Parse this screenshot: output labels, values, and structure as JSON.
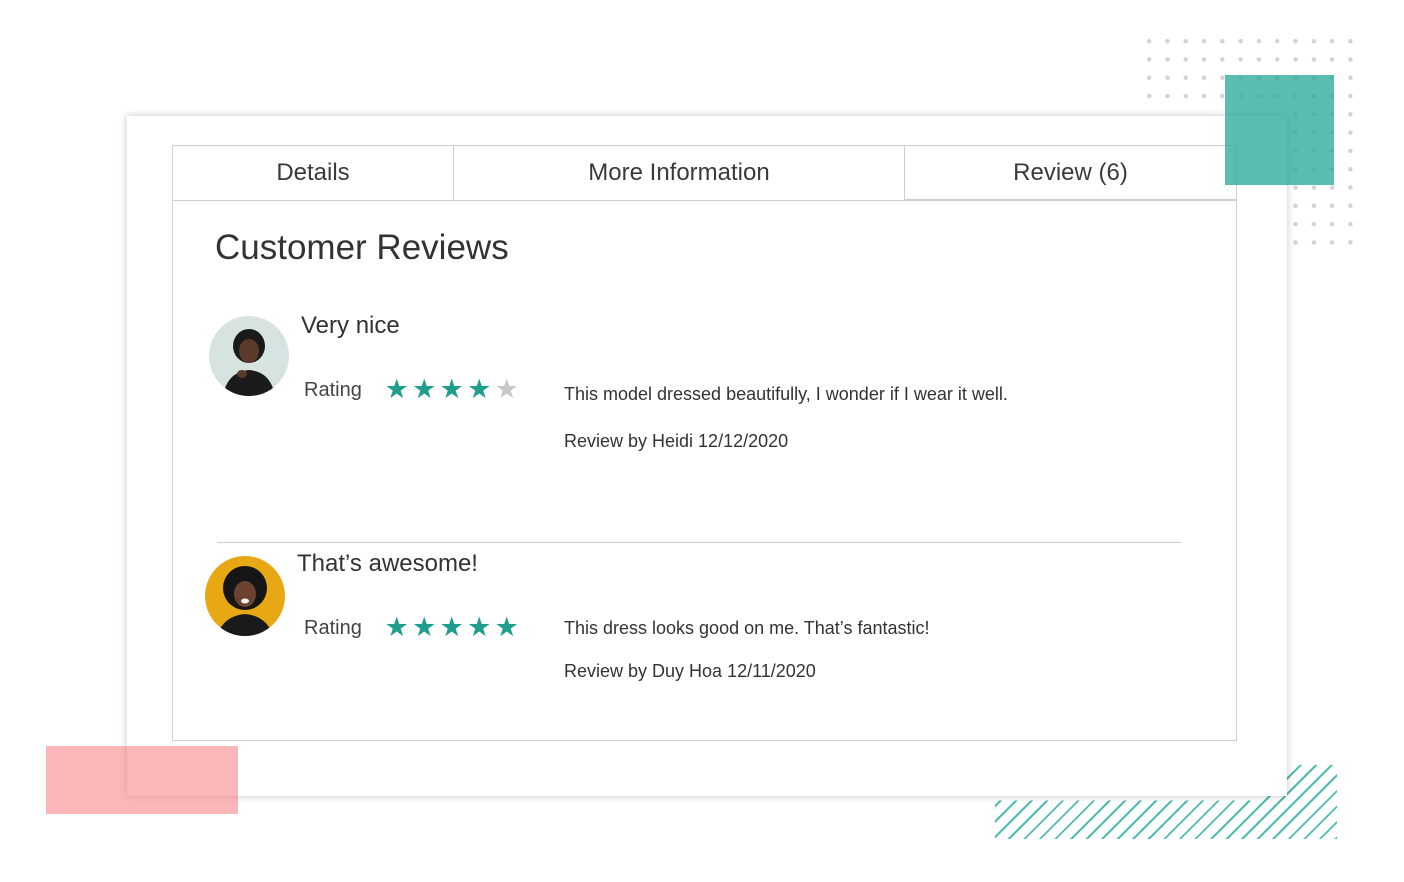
{
  "tabs": [
    {
      "label": "Details"
    },
    {
      "label": "More Information"
    },
    {
      "label": "Review (6)"
    }
  ],
  "section_title": "Customer Reviews",
  "reviews": [
    {
      "title": "Very nice",
      "rating_label": "Rating",
      "rating": 4,
      "max_rating": 5,
      "text": "This model dressed beautifully, I wonder if I wear it well.",
      "byline": "Review by Heidi 12/12/2020",
      "avatar_bg": "#d7e3e1"
    },
    {
      "title": "That’s awesome!",
      "rating_label": "Rating",
      "rating": 5,
      "max_rating": 5,
      "text": "This dress looks good on me. That’s  fantastic!",
      "byline": "Review by Duy Hoa 12/11/2020",
      "avatar_bg": "#e8a814"
    }
  ],
  "colors": {
    "star_on": "#1f9e8d",
    "star_off": "#c8c8c8",
    "accent_teal": "#2aab9c",
    "accent_pink": "#f47b80"
  }
}
